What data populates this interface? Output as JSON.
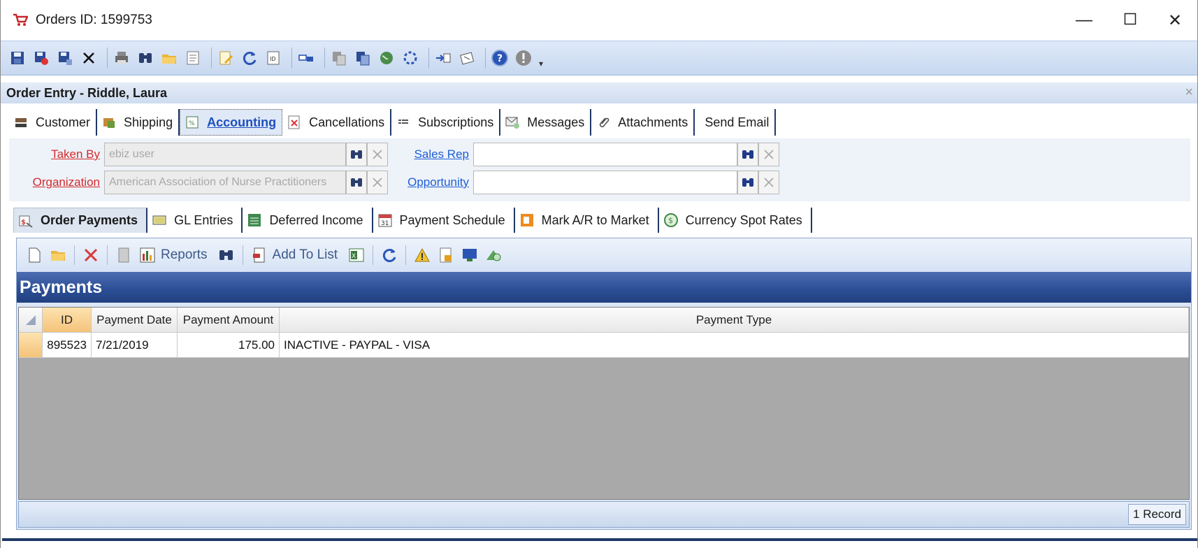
{
  "window": {
    "title": "Orders ID: 1599753",
    "app_icon": "shopping-cart-icon",
    "controls": [
      "minimize-icon",
      "maximize-icon",
      "close-icon"
    ]
  },
  "main_toolbar": {
    "icons": [
      "save-icon",
      "save-and-new-icon",
      "save-and-close-icon",
      "delete-icon",
      "print-icon",
      "find-icon",
      "open-folder-icon",
      "notes-icon",
      "edit-icon",
      "refresh-icon",
      "id-card-icon",
      "link-icon",
      "copy-icon",
      "copy-record-icon",
      "web-icon",
      "workflow-icon",
      "import-icon",
      "attach-icon",
      "help-icon",
      "info-icon"
    ]
  },
  "entry_header": {
    "title": "Order Entry - Riddle, Laura",
    "close": "×"
  },
  "main_tabs": [
    {
      "label": "Customer",
      "icon": "customer-icon",
      "active": false
    },
    {
      "label": "Shipping",
      "icon": "shipping-icon",
      "active": false
    },
    {
      "label": "Accounting",
      "icon": "accounting-icon",
      "active": true
    },
    {
      "label": "Cancellations",
      "icon": "cancellations-icon",
      "active": false
    },
    {
      "label": "Subscriptions",
      "icon": "subscriptions-icon",
      "active": false
    },
    {
      "label": "Messages",
      "icon": "messages-icon",
      "active": false
    },
    {
      "label": "Attachments",
      "icon": "paperclip-icon",
      "active": false
    },
    {
      "label": "Send Email",
      "icon": "",
      "active": false
    }
  ],
  "form": {
    "taken_by": {
      "label": "Taken By",
      "value": "ebiz user"
    },
    "organization": {
      "label": "Organization",
      "value": "American Association of Nurse Practitioners"
    },
    "sales_rep": {
      "label": "Sales Rep",
      "value": ""
    },
    "opportunity": {
      "label": "Opportunity",
      "value": ""
    }
  },
  "sub_tabs": [
    {
      "label": "Order Payments",
      "icon": "payments-icon",
      "active": true
    },
    {
      "label": "GL Entries",
      "icon": "gl-entries-icon",
      "active": false
    },
    {
      "label": "Deferred Income",
      "icon": "deferred-income-icon",
      "active": false
    },
    {
      "label": "Payment Schedule",
      "icon": "calendar-icon",
      "active": false
    },
    {
      "label": "Mark A/R to Market",
      "icon": "mark-ar-icon",
      "active": false
    },
    {
      "label": "Currency Spot Rates",
      "icon": "currency-icon",
      "active": false
    }
  ],
  "payments_toolbar": {
    "reports_label": "Reports",
    "add_to_list_label": "Add To List"
  },
  "payments": {
    "title": "Payments",
    "columns": [
      "ID",
      "Payment Date",
      "Payment Amount",
      "Payment Type"
    ],
    "rows": [
      {
        "id": "895523",
        "date": "7/21/2019",
        "amount": "175.00",
        "type": "INACTIVE - PAYPAL - VISA"
      }
    ],
    "record_count": "1 Record"
  },
  "colors": {
    "accent_blue": "#2b4d94",
    "toolbar_bg": "#c7d8f0",
    "label_red": "#d42b2b",
    "label_blue": "#1d5fd6",
    "selection_orange": "#f4c37a"
  }
}
